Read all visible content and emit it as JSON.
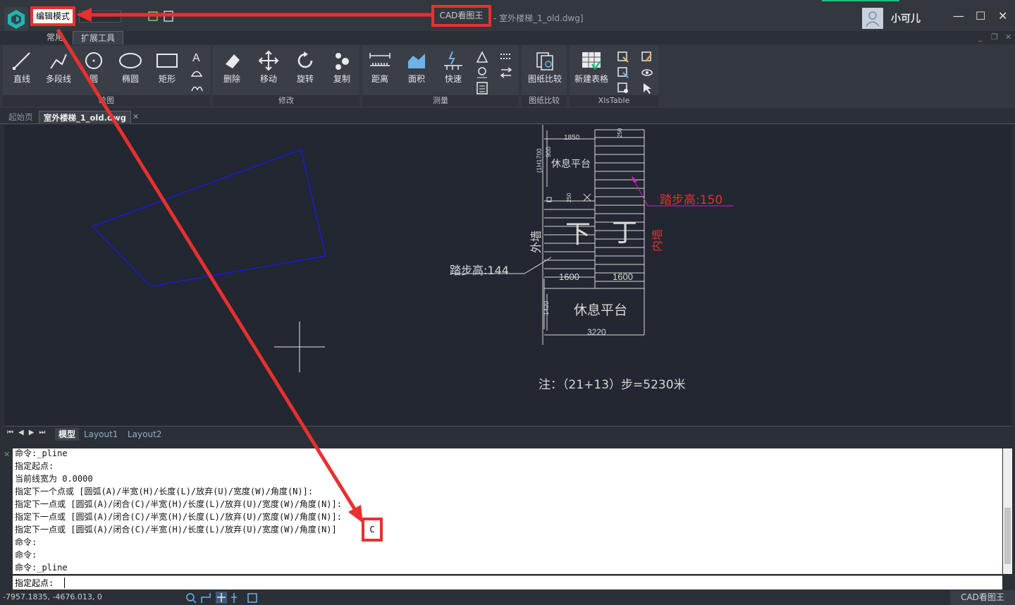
{
  "titlebar": {
    "mode_button": "编辑模式",
    "app_title": "CAD看图王",
    "file_title": "- 室外楼梯_1_old.dwg]",
    "user": "小可儿"
  },
  "ribbon_tabs": [
    "常用",
    "扩展工具"
  ],
  "ribbon": {
    "draw": {
      "title": "绘图",
      "tools": [
        "直线",
        "多段线",
        "圆",
        "椭圆",
        "矩形"
      ]
    },
    "modify": {
      "title": "修改",
      "tools": [
        "删除",
        "移动",
        "旋转",
        "复制"
      ]
    },
    "measure": {
      "title": "测量",
      "tools": [
        "距离",
        "面积",
        "快速"
      ]
    },
    "compare": {
      "title": "图纸比较",
      "tools": [
        "图纸比较"
      ]
    },
    "xls": {
      "title": "XlsTable",
      "tools": [
        "新建表格"
      ]
    }
  },
  "doc_tabs": [
    "起始页",
    "室外楼梯_1_old.dwg"
  ],
  "drawing": {
    "dim_1850": "1850",
    "dim_900": "900",
    "dim_1700": "(1H1700",
    "platform_top": "休息平台",
    "step_label_right": "踏步高:150",
    "outer_wall": "外墙",
    "inner_wall": "内墙",
    "down_char": "下",
    "up_char": "丁",
    "step_label_left": "踏步高:144",
    "dim_1600_left": "1600",
    "dim_1600_right": "1600",
    "platform_bottom": "休息平台",
    "dim_1420": "1420",
    "dim_3220": "3220",
    "note": "注：（21+13）步=5230米",
    "dim_small_1": "250",
    "dim_small_2": "250"
  },
  "layout_tabs": [
    "模型",
    "Layout1",
    "Layout2"
  ],
  "command": {
    "lines": [
      "命令:_pline",
      "指定起点:",
      "当前线宽为 0.0000",
      "指定下一个点或 [圆弧(A)/半宽(H)/长度(L)/放弃(U)/宽度(W)/角度(N)]:",
      "指定下一点或 [圆弧(A)/闭合(C)/半宽(H)/长度(L)/放弃(U)/宽度(W)/角度(N)]:",
      "指定下一点或 [圆弧(A)/闭合(C)/半宽(H)/长度(L)/放弃(U)/宽度(W)/角度(N)]:",
      "指定下一点或 [圆弧(A)/闭合(C)/半宽(H)/长度(L)/放弃(U)/宽度(W)/角度(N)]",
      "命令:",
      "命令:",
      "命令:_pline"
    ],
    "highlight_value": "C",
    "prompt": "指定起点:"
  },
  "status": {
    "coords": "-7957.1835, -4676.013, 0",
    "app": "CAD看图王"
  },
  "colors": {
    "highlight": "#e83030",
    "accent": "#1ec07a"
  }
}
